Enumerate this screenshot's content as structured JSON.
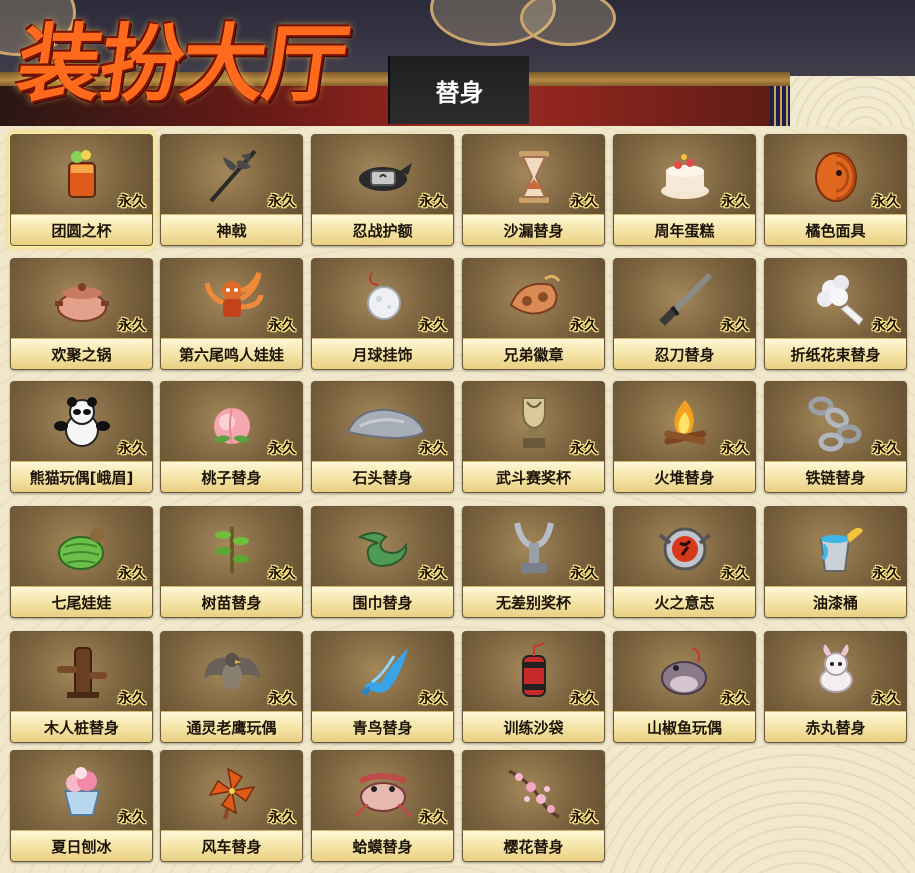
{
  "header": {
    "title": "装扮大厅",
    "active_tab": "替身"
  },
  "badge_label": "永久",
  "colors": {
    "title_orange": "#ff6a1c",
    "label_gold": "#f4e3a4",
    "card_brown": "#7c6440"
  },
  "items": [
    {
      "label": "团圆之杯",
      "icon": "cup-icon",
      "selected": true
    },
    {
      "label": "神戟",
      "icon": "halberd-icon"
    },
    {
      "label": "忍战护额",
      "icon": "headband-icon"
    },
    {
      "label": "沙漏替身",
      "icon": "hourglass-icon"
    },
    {
      "label": "周年蛋糕",
      "icon": "cake-icon"
    },
    {
      "label": "橘色面具",
      "icon": "mask-icon"
    },
    {
      "label": "欢聚之锅",
      "icon": "pot-icon"
    },
    {
      "label": "第六尾鸣人娃娃",
      "icon": "fox-doll-icon"
    },
    {
      "label": "月球挂饰",
      "icon": "moon-charm-icon"
    },
    {
      "label": "兄弟徽章",
      "icon": "badge-icon"
    },
    {
      "label": "忍刀替身",
      "icon": "sword-icon"
    },
    {
      "label": "折纸花束替身",
      "icon": "bouquet-icon"
    },
    {
      "label": "熊猫玩偶[峨眉]",
      "icon": "panda-icon"
    },
    {
      "label": "桃子替身",
      "icon": "peach-icon"
    },
    {
      "label": "石头替身",
      "icon": "stone-icon"
    },
    {
      "label": "武斗赛奖杯",
      "icon": "trophy-icon"
    },
    {
      "label": "火堆替身",
      "icon": "campfire-icon"
    },
    {
      "label": "铁链替身",
      "icon": "chain-icon"
    },
    {
      "label": "七尾娃娃",
      "icon": "cocoon-doll-icon"
    },
    {
      "label": "树苗替身",
      "icon": "sapling-icon"
    },
    {
      "label": "围巾替身",
      "icon": "scarf-icon"
    },
    {
      "label": "无差别奖杯",
      "icon": "silver-trophy-icon"
    },
    {
      "label": "火之意志",
      "icon": "fire-will-icon"
    },
    {
      "label": "油漆桶",
      "icon": "paint-bucket-icon"
    },
    {
      "label": "木人桩替身",
      "icon": "wooden-dummy-icon"
    },
    {
      "label": "通灵老鹰玩偶",
      "icon": "hawk-doll-icon"
    },
    {
      "label": "青鸟替身",
      "icon": "blue-bird-icon"
    },
    {
      "label": "训练沙袋",
      "icon": "punching-bag-icon"
    },
    {
      "label": "山椒鱼玩偶",
      "icon": "salamander-doll-icon"
    },
    {
      "label": "赤丸替身",
      "icon": "dog-icon"
    },
    {
      "label": "夏日刨冰",
      "icon": "shaved-ice-icon"
    },
    {
      "label": "风车替身",
      "icon": "pinwheel-icon"
    },
    {
      "label": "蛤蟆替身",
      "icon": "toad-icon"
    },
    {
      "label": "樱花替身",
      "icon": "sakura-branch-icon"
    }
  ]
}
